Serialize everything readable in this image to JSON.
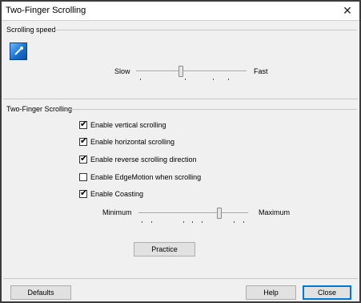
{
  "window": {
    "title": "Two-Finger Scrolling",
    "close_glyph": "✕"
  },
  "speed_group": {
    "label": "Scrolling speed",
    "icon": "two-finger-scroll-icon",
    "slider": {
      "min_label": "Slow",
      "max_label": "Fast",
      "value_fraction": 0.4
    }
  },
  "scroll_group": {
    "label": "Two-Finger Scrolling",
    "options": [
      {
        "label": "Enable vertical scrolling",
        "checked": true
      },
      {
        "label": "Enable horizontal scrolling",
        "checked": true
      },
      {
        "label": "Enable reverse scrolling direction",
        "checked": true
      },
      {
        "label": "Enable EdgeMotion when scrolling",
        "checked": false
      },
      {
        "label": "Enable Coasting",
        "checked": true
      }
    ],
    "coasting_slider": {
      "min_label": "Minimum",
      "max_label": "Maximum",
      "value_fraction": 0.75
    },
    "practice_label": "Practice"
  },
  "footer": {
    "defaults_label": "Defaults",
    "help_label": "Help",
    "close_label": "Close"
  },
  "colors": {
    "focus_border": "#0078d7",
    "window_bg": "#f0f0f0"
  }
}
